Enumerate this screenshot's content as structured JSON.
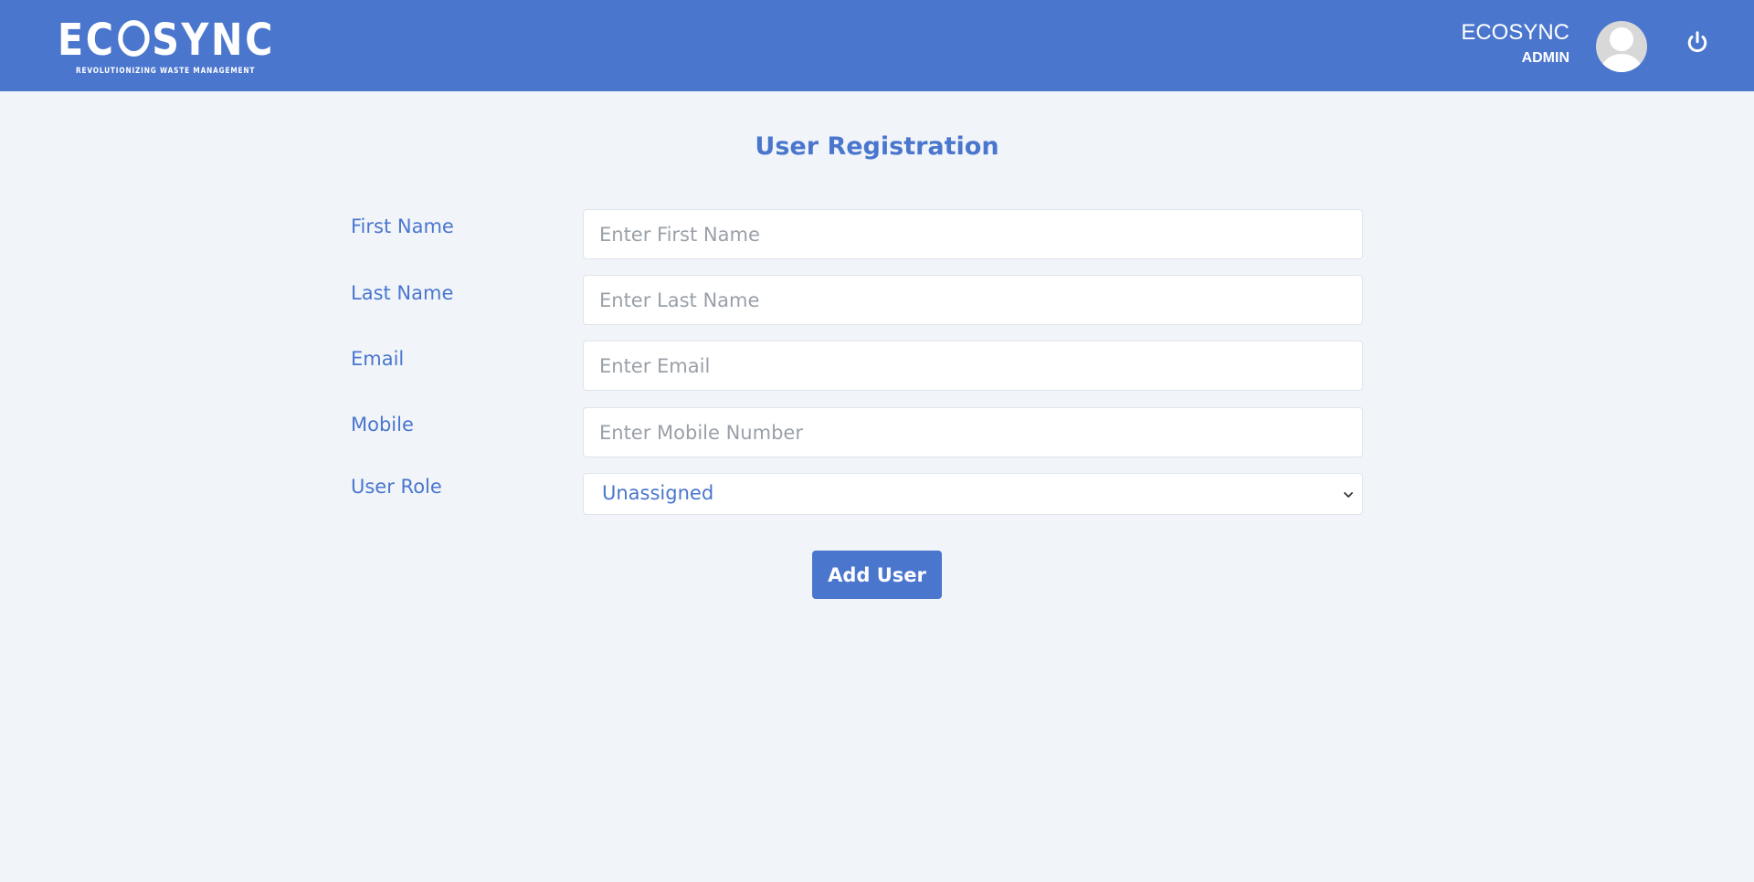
{
  "header": {
    "logo_word": "ECOSYNC",
    "logo_tagline": "REVOLUTIONIZING WASTE MANAGEMENT",
    "user_name": "ECOSYNC",
    "user_role": "ADMIN",
    "avatar_icon": "user-avatar-icon",
    "logout_icon": "power-icon",
    "brand_color": "#4a76cd"
  },
  "form": {
    "title": "User Registration",
    "fields": [
      {
        "label": "First Name",
        "placeholder": "Enter First Name",
        "value": ""
      },
      {
        "label": "Last Name",
        "placeholder": "Enter Last Name",
        "value": ""
      },
      {
        "label": "Email",
        "placeholder": "Enter Email",
        "value": ""
      },
      {
        "label": "Mobile",
        "placeholder": "Enter Mobile Number",
        "value": ""
      }
    ],
    "role": {
      "label": "User Role",
      "selected": "Unassigned"
    },
    "submit_label": "Add User"
  }
}
